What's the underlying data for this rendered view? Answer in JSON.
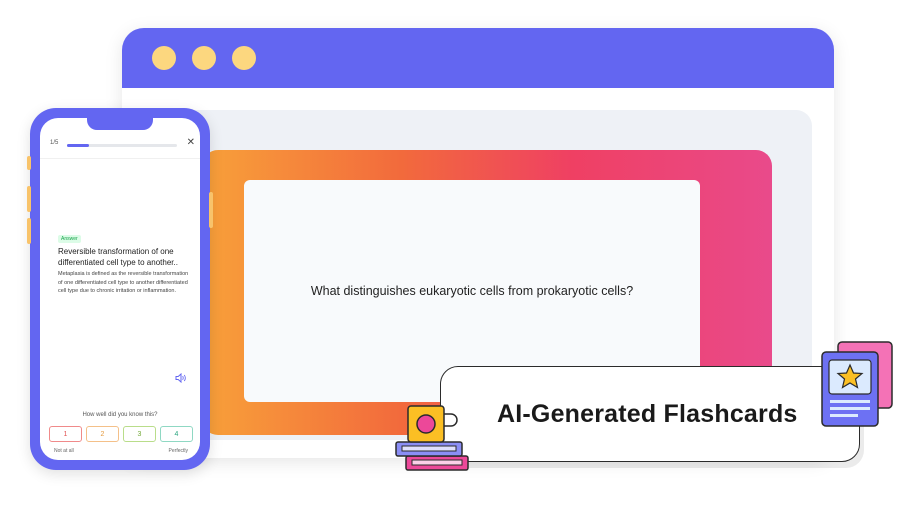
{
  "browser": {
    "window_dots": [
      "yellow-dot",
      "yellow-dot",
      "yellow-dot"
    ],
    "accent_color": "#6366f1",
    "flashcard": {
      "question": "What distinguishes eukaryotic cells from prokaryotic cells?"
    }
  },
  "phone": {
    "progress": {
      "label": "1/5",
      "fraction": 0.2
    },
    "answer_badge": "Answer",
    "answer_title": "Reversible transformation of one differentiated cell type to another..",
    "answer_body": "Metaplasia is defined as the reversible transformation of one differentiated cell type to another differentiated cell type due to chronic irritation or inflammation.",
    "knowledge_question": "How well did you know this?",
    "ratings": [
      "1",
      "2",
      "3",
      "4"
    ],
    "scale_low": "Not at all",
    "scale_high": "Perfectly"
  },
  "label": {
    "text": "AI-Generated Flashcards"
  },
  "icons": [
    "close-icon",
    "speaker-icon",
    "mug-books-icon",
    "star-cards-icon"
  ]
}
